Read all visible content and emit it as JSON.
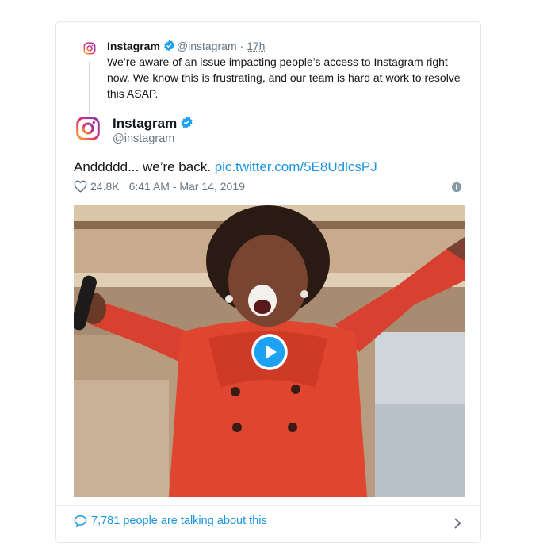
{
  "parent_tweet": {
    "name": "Instagram",
    "handle": "@instagram",
    "separator": "·",
    "time": "17h",
    "text": "We’re aware of an issue impacting people’s access to Instagram right now. We know this is frustrating, and our team is hard at work to resolve this ASAP."
  },
  "main_tweet": {
    "name": "Instagram",
    "handle": "@instagram",
    "text": "Anddddd... we’re back.",
    "link": "pic.twitter.com/5E8UdlcsPJ",
    "likes": "24.8K",
    "timestamp": "6:41 AM - Mar 14, 2019"
  },
  "footer": {
    "talking": "7,781 people are talking about this"
  },
  "colors": {
    "link": "#1b95e0",
    "verified": "#1da1f2",
    "muted": "#657786"
  },
  "icons": [
    "instagram-logo-icon",
    "verified-badge-icon",
    "heart-icon",
    "info-icon",
    "play-icon",
    "comment-bubble-icon",
    "chevron-right-icon"
  ]
}
